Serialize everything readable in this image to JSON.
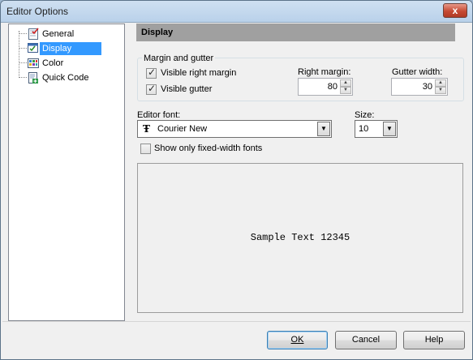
{
  "window": {
    "title": "Editor Options",
    "close_glyph": "x"
  },
  "tree": {
    "items": [
      {
        "label": "General",
        "icon": "checklist-icon"
      },
      {
        "label": "Display",
        "icon": "display-check-icon",
        "selected": true
      },
      {
        "label": "Color",
        "icon": "color-grid-icon"
      },
      {
        "label": "Quick Code",
        "icon": "quick-code-icon"
      }
    ]
  },
  "panel": {
    "header": "Display"
  },
  "margin_group": {
    "title": "Margin and gutter",
    "visible_right_margin": {
      "label": "Visible right margin",
      "checked": true
    },
    "visible_gutter": {
      "label": "Visible gutter",
      "checked": true
    },
    "right_margin": {
      "label": "Right margin:",
      "value": "80"
    },
    "gutter_width": {
      "label": "Gutter width:",
      "value": "30"
    }
  },
  "font": {
    "label": "Editor font:",
    "value": "Courier New",
    "size_label": "Size:",
    "size_value": "10",
    "fixed_width_only": {
      "label": "Show only fixed-width fonts",
      "checked": false
    }
  },
  "preview": {
    "sample_text": "Sample Text 12345"
  },
  "buttons": {
    "ok": {
      "label": "OK",
      "accel": "O"
    },
    "cancel": {
      "label": "Cancel",
      "accel": "C"
    },
    "help": {
      "label": "Help",
      "accel": "H"
    }
  },
  "colors": {
    "selection": "#3399ff",
    "header": "#a0a0a0",
    "close": "#c64a34"
  }
}
